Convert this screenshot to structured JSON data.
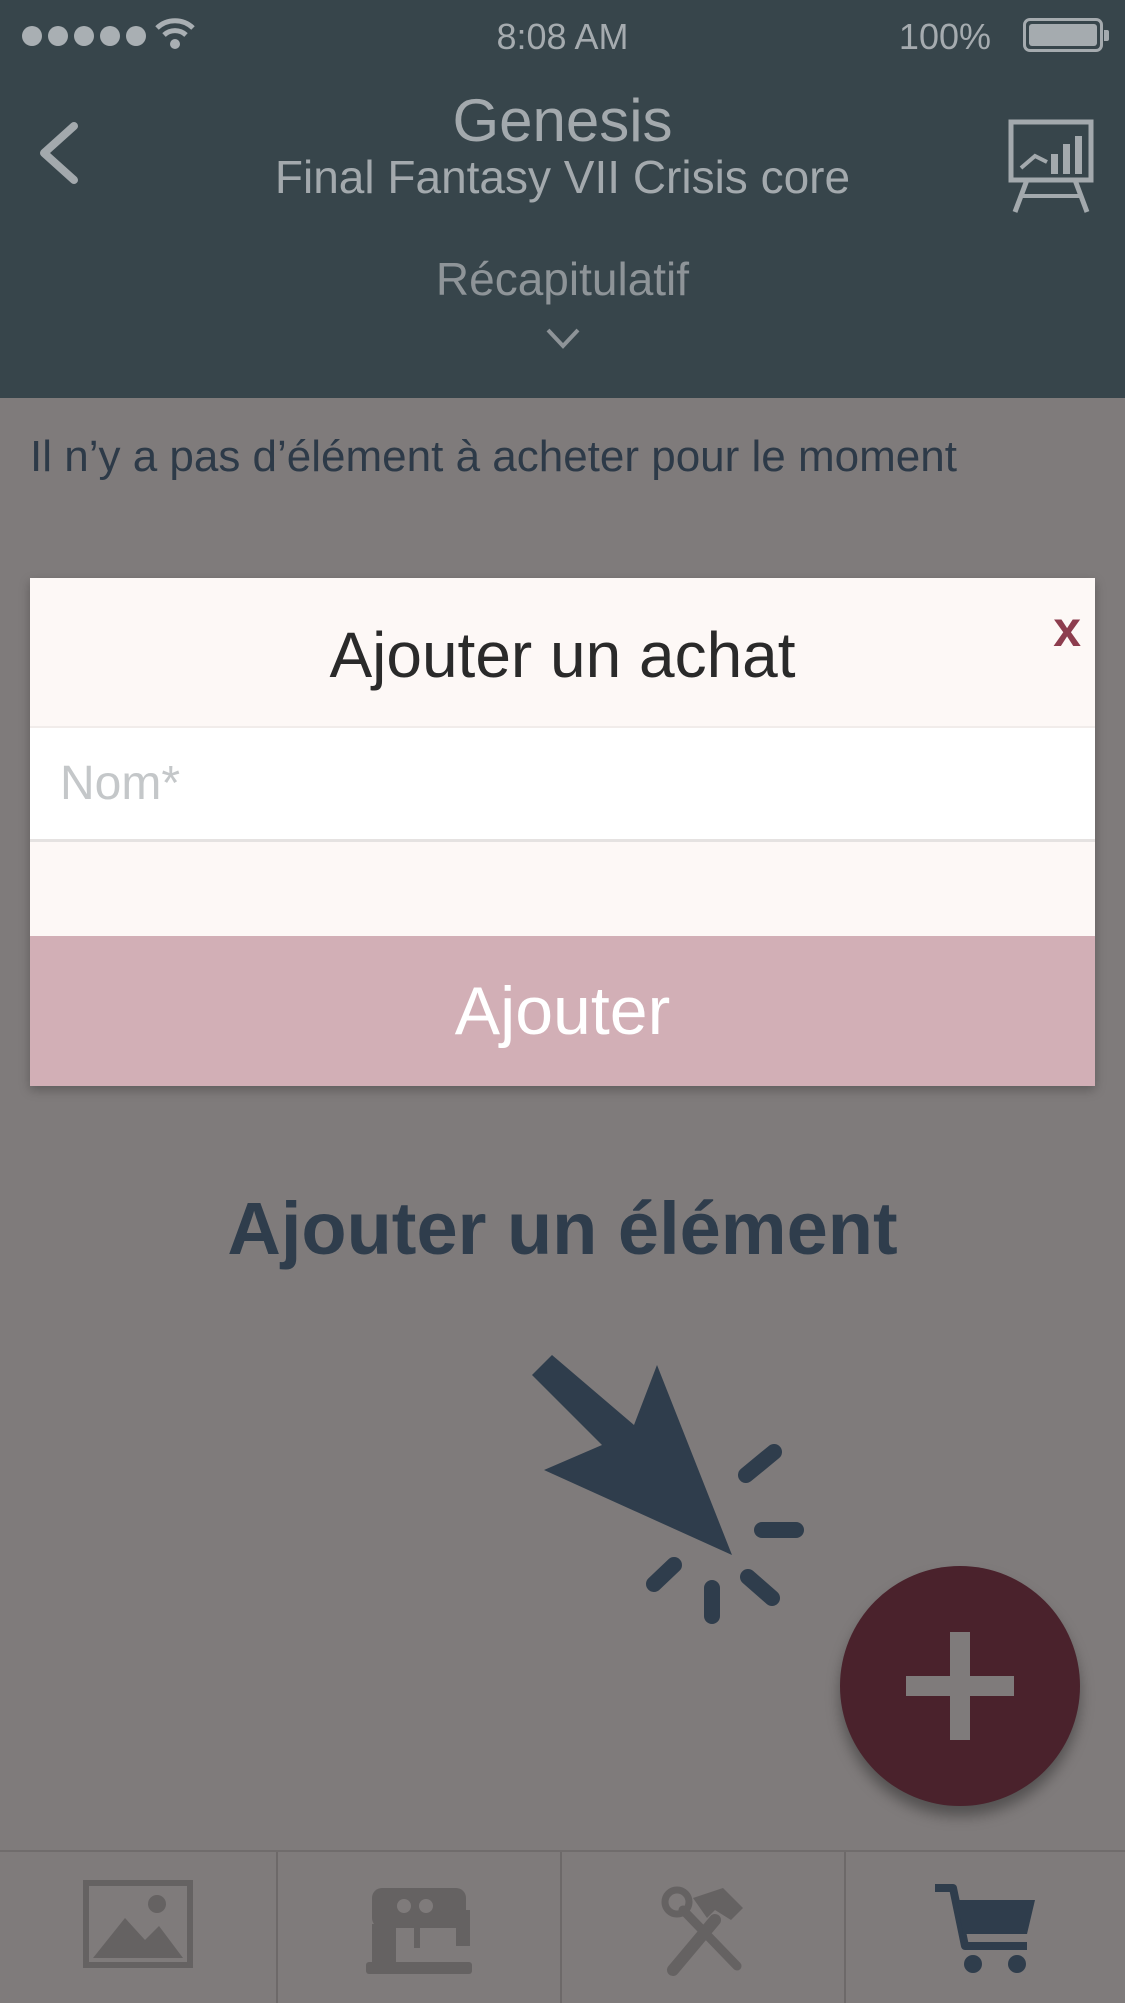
{
  "status_bar": {
    "time": "8:08 AM",
    "battery": "100%",
    "signal_icon": "signal-dots-icon",
    "wifi_icon": "wifi-icon",
    "battery_icon": "battery-icon"
  },
  "header": {
    "title": "Genesis",
    "subtitle": "Final Fantasy VII Crisis core",
    "section": "Récapitulatif",
    "back_icon": "chevron-left-icon",
    "stats_icon": "presentation-chart-icon",
    "expand_icon": "chevron-down-icon"
  },
  "content": {
    "empty_message": "Il n’y a pas d’élément à acheter pour le moment",
    "add_heading": "Ajouter un élément",
    "pointer_icon": "cursor-click-icon"
  },
  "modal": {
    "title": "Ajouter un achat",
    "close_label": "x",
    "name_placeholder": "Nom*",
    "name_value": "",
    "submit_label": "Ajouter"
  },
  "fab": {
    "icon": "plus-icon"
  },
  "tabbar": {
    "tabs": [
      {
        "icon": "image-icon",
        "active": false
      },
      {
        "icon": "sewing-machine-icon",
        "active": false
      },
      {
        "icon": "tools-icon",
        "active": false
      },
      {
        "icon": "cart-icon",
        "active": true
      }
    ]
  },
  "colors": {
    "header_bg": "#37454b",
    "overlay_bg": "#7f7b7b",
    "accent": "#4a222c",
    "button_bg": "#d2afb6",
    "close_color": "#8d3d4e",
    "heading_color": "#2f3d4c"
  }
}
